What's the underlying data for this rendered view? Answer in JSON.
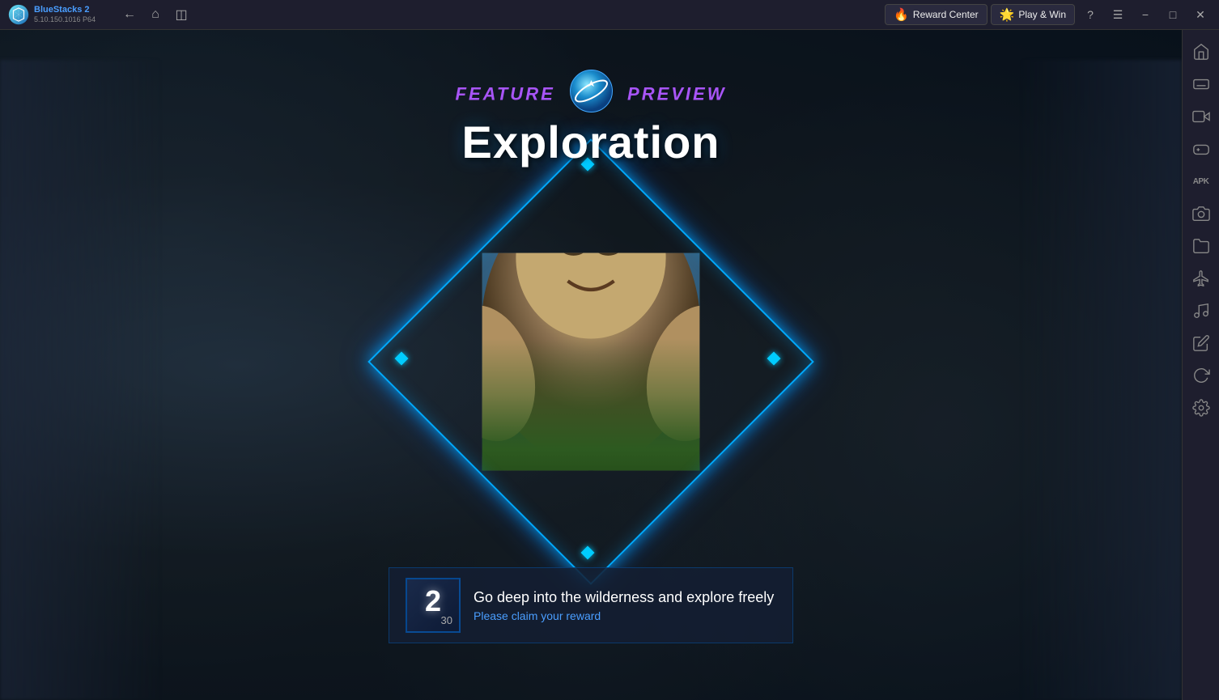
{
  "titlebar": {
    "app_name": "BlueStacks 2",
    "version": "5.10.150.1016  P64",
    "reward_center_label": "Reward Center",
    "play_win_label": "Play & Win"
  },
  "main": {
    "feature_label_left": "Feature",
    "feature_label_right": "Preview",
    "exploration_title": "Exploration",
    "main_text": "Go deep into the wilderness and explore freely",
    "sub_text": "Please claim your reward",
    "badge_number": "2",
    "badge_sub": "30"
  },
  "sidebar": {
    "icons": [
      {
        "name": "home-icon",
        "symbol": "⌂"
      },
      {
        "name": "keyboard-icon",
        "symbol": "⌨"
      },
      {
        "name": "camera-icon",
        "symbol": "📷"
      },
      {
        "name": "gamepad-icon",
        "symbol": "🎮"
      },
      {
        "name": "apk-icon",
        "symbol": "APK"
      },
      {
        "name": "screenshot-icon",
        "symbol": "📸"
      },
      {
        "name": "folder-icon",
        "symbol": "📁"
      },
      {
        "name": "move-icon",
        "symbol": "✈"
      },
      {
        "name": "media-icon",
        "symbol": "🎵"
      },
      {
        "name": "brush-icon",
        "symbol": "🖌"
      },
      {
        "name": "refresh-icon",
        "symbol": "↻"
      },
      {
        "name": "settings-icon",
        "symbol": "⚙"
      }
    ]
  }
}
